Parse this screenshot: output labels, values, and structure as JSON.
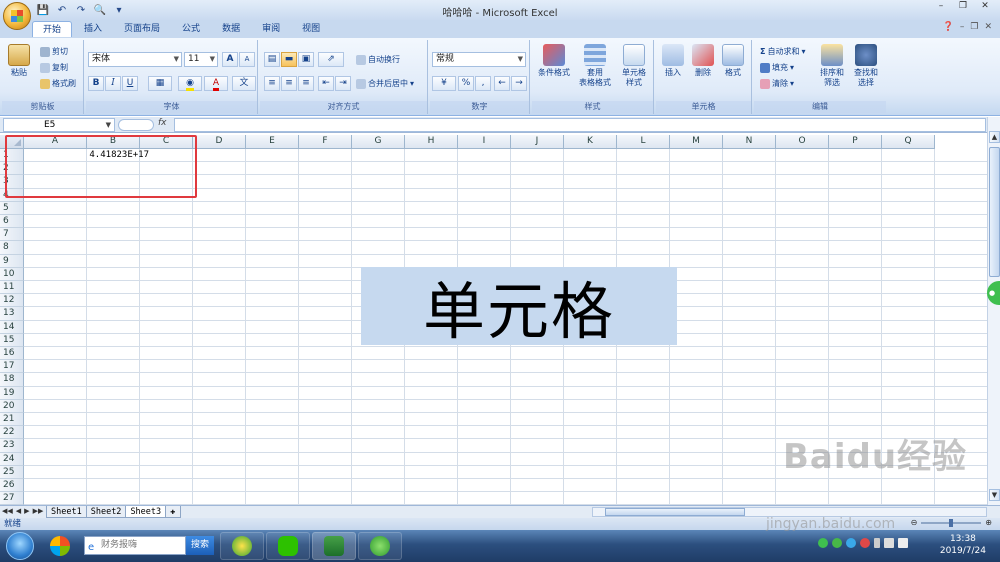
{
  "titlebar": {
    "title": "哈哈哈 - Microsoft Excel"
  },
  "tabs": [
    "开始",
    "插入",
    "页面布局",
    "公式",
    "数据",
    "审阅",
    "视图"
  ],
  "ribbon": {
    "clipboard": {
      "paste": "粘贴",
      "cut": "剪切",
      "copy": "复制",
      "format_painter": "格式刷",
      "label": "剪贴板"
    },
    "font": {
      "name": "宋体",
      "size": "11",
      "label": "字体",
      "bold": "B",
      "italic": "I",
      "underline": "U",
      "grow": "A",
      "shrink": "A"
    },
    "alignment": {
      "wrap": "自动换行",
      "merge": "合并后居中",
      "label": "对齐方式"
    },
    "number": {
      "format": "常规",
      "percent": "%",
      "comma": ",",
      "label": "数字"
    },
    "styles": {
      "conditional": "条件格式",
      "table_1": "套用",
      "table_2": "表格格式",
      "cell_1": "单元格",
      "cell_2": "样式",
      "label": "样式"
    },
    "cells": {
      "insert": "插入",
      "delete": "删除",
      "format": "格式",
      "label": "单元格"
    },
    "editing": {
      "autosum": "自动求和",
      "fill": "填充",
      "clear": "清除",
      "sort_1": "排序和",
      "sort_2": "筛选",
      "find_1": "查找和",
      "find_2": "选择",
      "label": "编辑"
    }
  },
  "formula_bar": {
    "name_box": "E5",
    "fx": "fx",
    "value": ""
  },
  "grid": {
    "columns": [
      "A",
      "B",
      "C",
      "D",
      "E",
      "F",
      "G",
      "H",
      "I",
      "J",
      "K",
      "L",
      "M",
      "N",
      "O",
      "P",
      "Q"
    ],
    "rows": [
      "1",
      "2",
      "3",
      "4",
      "5",
      "6",
      "7",
      "8",
      "9",
      "10",
      "11",
      "12",
      "13",
      "14",
      "15",
      "16",
      "17",
      "18",
      "19",
      "20",
      "21",
      "22",
      "23",
      "24",
      "25",
      "26",
      "27"
    ],
    "cell_a1": "4.41823E+17"
  },
  "overlay_text": "单元格",
  "sheets": [
    "Sheet1",
    "Sheet2",
    "Sheet3"
  ],
  "active_sheet": "Sheet3",
  "status": {
    "text": "就绪"
  },
  "taskbar": {
    "search_placeholder": "财务报嗨",
    "search_button": "搜索",
    "time": "13:38",
    "date": "2019/7/24"
  },
  "watermark": {
    "brand": "Baidu经验",
    "url": "jingyan.baidu.com"
  },
  "colors": {
    "ribbon_blue": "#dfeaf8",
    "highlight_red": "#e0393e",
    "overlay_bg": "#c6d9ef"
  }
}
